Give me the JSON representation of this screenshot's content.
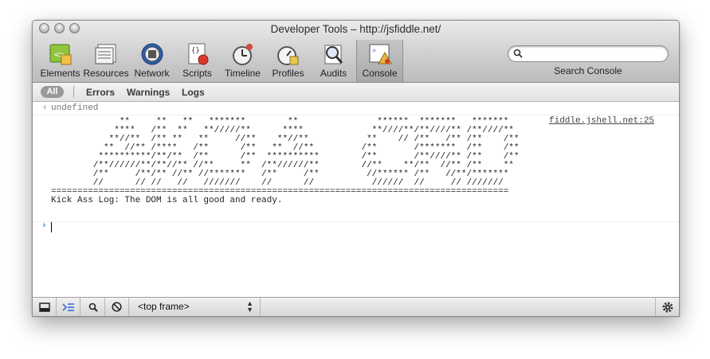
{
  "window": {
    "title": "Developer Tools – http://jsfiddle.net/"
  },
  "toolbar": {
    "items": [
      {
        "label": "Elements",
        "icon": "elements-icon"
      },
      {
        "label": "Resources",
        "icon": "resources-icon"
      },
      {
        "label": "Network",
        "icon": "network-icon"
      },
      {
        "label": "Scripts",
        "icon": "scripts-icon"
      },
      {
        "label": "Timeline",
        "icon": "timeline-icon"
      },
      {
        "label": "Profiles",
        "icon": "profiles-icon"
      },
      {
        "label": "Audits",
        "icon": "audits-icon"
      },
      {
        "label": "Console",
        "icon": "console-icon",
        "active": true
      }
    ],
    "search_label": "Search Console",
    "search_value": ""
  },
  "filters": {
    "all": "All",
    "errors": "Errors",
    "warnings": "Warnings",
    "logs": "Logs"
  },
  "console": {
    "undefined_text": "undefined",
    "source_link": "fiddle.jshell.net:25",
    "ascii_art": "             **     **   **   *******        **               ******  *******   *******\n            ****   /**  **   **/////**      ****             **////**/**////** /**////**\n           **//**  /** **   **     //**    **//**           **    // /**   /** /**    /**\n          **  //** /****   /**      /**   **  //**         /**       /*******  /**    /**\n         **********/**/**  /**      /**  **********        /**       /**////** /**    /**\n        /**//////**/**//** //**     **  /**//////**        //**    **/**  //** /**    **\n        /**     /**/** //** //*******   /**     /**         //****** /**   //**/*******\n        //      // //   //   ///////    //      //           //////  //     // ///////\n=======================================================================================",
    "log_message": "Kick Ass Log: The DOM is all good and ready."
  },
  "statusbar": {
    "frame_select": "<top frame>"
  }
}
